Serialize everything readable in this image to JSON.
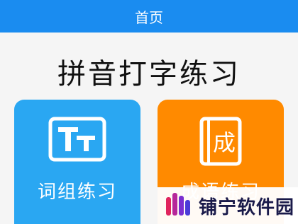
{
  "topbar": {
    "title": "首页"
  },
  "main": {
    "heading": "拼音打字练习",
    "cards": [
      {
        "label": "词组练习",
        "icon": "tt-text-icon",
        "color": "#2aa7f2"
      },
      {
        "label": "成语练习",
        "icon": "cheng-book-icon",
        "icon_char": "成",
        "color": "#ff8a00"
      }
    ]
  },
  "watermark": {
    "text": "铺宁软件园",
    "icon": "bars-logo-icon"
  },
  "colors": {
    "topbar": "#1a8cf0",
    "background": "#f5f5f5"
  }
}
